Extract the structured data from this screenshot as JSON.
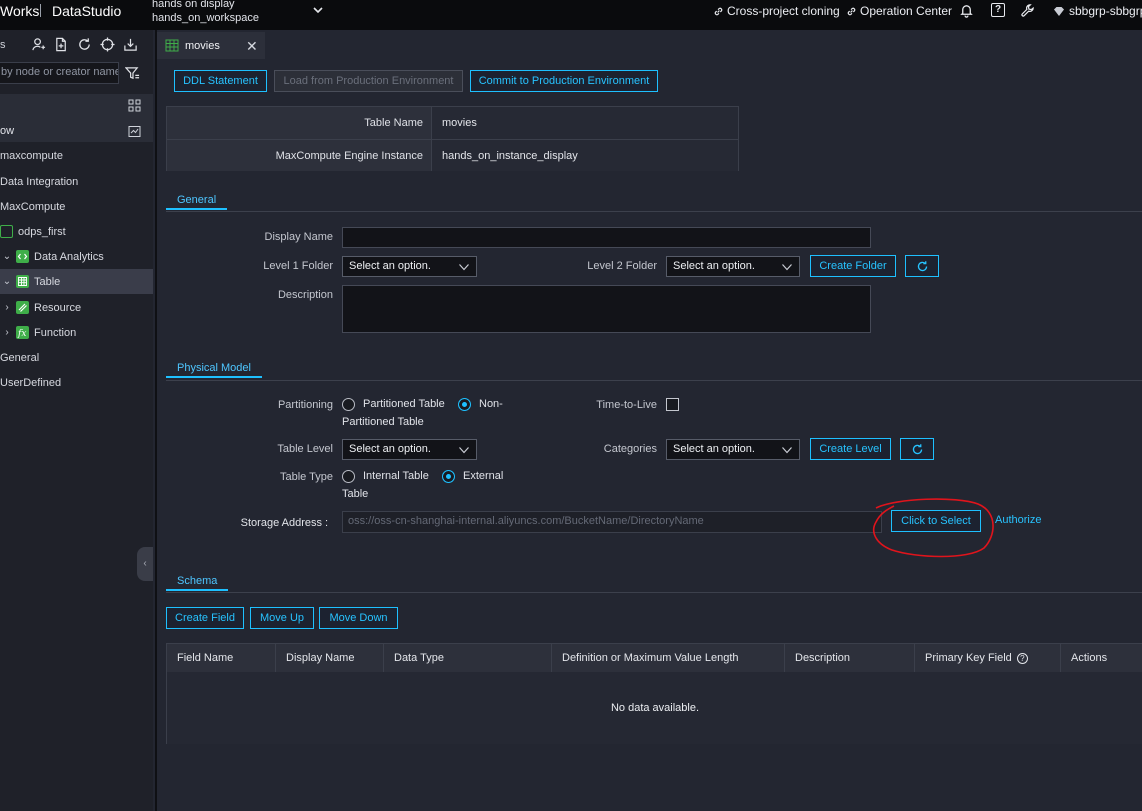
{
  "topbar": {
    "brand": "Works",
    "product": "DataStudio",
    "workspace_line1": "hands on display",
    "workspace_line2": "hands_on_workspace",
    "cross_project": "Cross-project cloning",
    "operation_center": "Operation Center",
    "account": "sbbgrp-sbbgrp"
  },
  "sidebar": {
    "top_label": "s",
    "search_placeholder": "by node or creator name",
    "section_label": "ow",
    "tree": [
      {
        "label": "maxcompute"
      },
      {
        "label": "Data Integration"
      },
      {
        "label": "MaxCompute"
      },
      {
        "label": "odps_first"
      },
      {
        "label": "Data Analytics"
      },
      {
        "label": "Table"
      },
      {
        "label": "Resource"
      },
      {
        "label": "Function"
      },
      {
        "label": "General"
      },
      {
        "label": "UserDefined"
      }
    ]
  },
  "tab": {
    "label": "movies"
  },
  "toolbar": {
    "ddl": "DDL Statement",
    "load": "Load from Production Environment",
    "commit": "Commit to Production Environment"
  },
  "info": {
    "table_name_label": "Table Name",
    "table_name_value": "movies",
    "engine_label": "MaxCompute Engine Instance",
    "engine_value": "hands_on_instance_display"
  },
  "general": {
    "section": "General",
    "display_name_label": "Display Name",
    "display_name_value": "",
    "level1_label": "Level 1 Folder",
    "level1_value": "Select an option.",
    "level2_label": "Level 2 Folder",
    "level2_value": "Select an option.",
    "create_folder": "Create Folder",
    "description_label": "Description",
    "description_value": ""
  },
  "physical": {
    "section": "Physical Model",
    "partitioning_label": "Partitioning",
    "partitioned": "Partitioned Table",
    "non_partitioned_a": "Non-",
    "non_partitioned_b": "Partitioned Table",
    "ttl_label": "Time-to-Live",
    "table_level_label": "Table Level",
    "table_level_value": "Select an option.",
    "categories_label": "Categories",
    "categories_value": "Select an option.",
    "create_level": "Create Level",
    "table_type_label": "Table Type",
    "internal": "Internal Table",
    "external_a": "External",
    "external_b": "Table",
    "storage_label": "Storage Address",
    "storage_colon": ":",
    "storage_placeholder": "oss://oss-cn-shanghai-internal.aliyuncs.com/BucketName/DirectoryName",
    "click_to_select": "Click to Select",
    "authorize": "Authorize"
  },
  "schema": {
    "section": "Schema",
    "create_field": "Create Field",
    "move_up": "Move Up",
    "move_down": "Move Down",
    "columns": [
      "Field Name",
      "Display Name",
      "Data Type",
      "Definition or Maximum Value Length",
      "Description",
      "Primary Key Field",
      "Actions"
    ],
    "empty": "No data available."
  },
  "colors": {
    "accent": "#1ec0ff",
    "annotation": "#e0141c"
  }
}
